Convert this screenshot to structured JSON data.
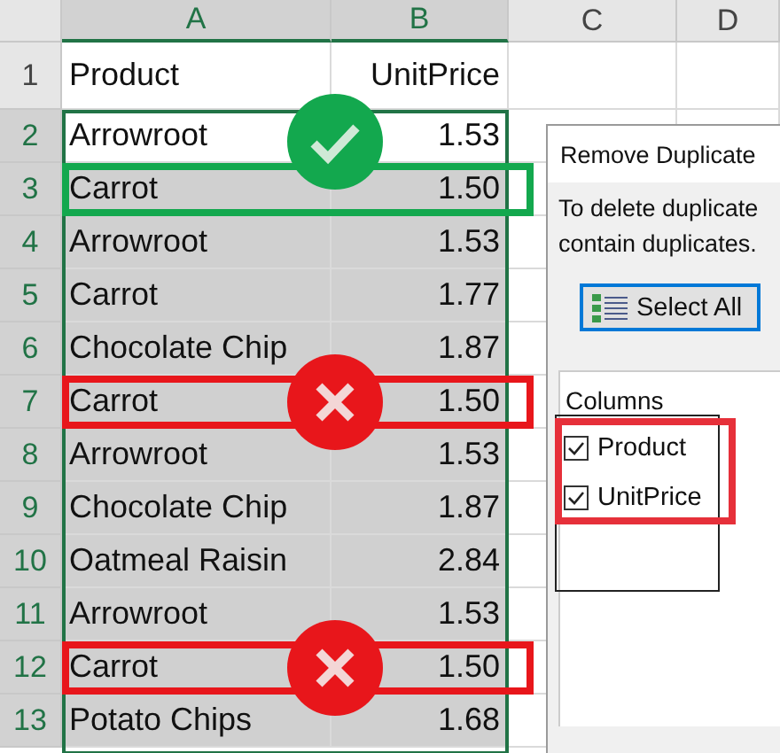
{
  "column_headers": [
    {
      "label": "A",
      "selected": true
    },
    {
      "label": "B",
      "selected": true
    },
    {
      "label": "C",
      "selected": false
    },
    {
      "label": "D",
      "selected": false
    }
  ],
  "rows": [
    {
      "number": "1",
      "cells": [
        "Product",
        "UnitPrice"
      ],
      "selected": false,
      "active": false,
      "kind": "normal"
    },
    {
      "number": "2",
      "cells": [
        "Arrowroot",
        "1.53"
      ],
      "selected": true,
      "active": true,
      "kind": "normal"
    },
    {
      "number": "3",
      "cells": [
        "Carrot",
        "1.50"
      ],
      "selected": true,
      "active": false,
      "kind": "keep"
    },
    {
      "number": "4",
      "cells": [
        "Arrowroot",
        "1.53"
      ],
      "selected": true,
      "active": false,
      "kind": "normal"
    },
    {
      "number": "5",
      "cells": [
        "Carrot",
        "1.77"
      ],
      "selected": true,
      "active": false,
      "kind": "normal"
    },
    {
      "number": "6",
      "cells": [
        "Chocolate Chip",
        "1.87"
      ],
      "selected": true,
      "active": false,
      "kind": "normal"
    },
    {
      "number": "7",
      "cells": [
        "Carrot",
        "1.50"
      ],
      "selected": true,
      "active": false,
      "kind": "remove"
    },
    {
      "number": "8",
      "cells": [
        "Arrowroot",
        "1.53"
      ],
      "selected": true,
      "active": false,
      "kind": "normal"
    },
    {
      "number": "9",
      "cells": [
        "Chocolate Chip",
        "1.87"
      ],
      "selected": true,
      "active": false,
      "kind": "normal"
    },
    {
      "number": "10",
      "cells": [
        "Oatmeal Raisin",
        "2.84"
      ],
      "selected": true,
      "active": false,
      "kind": "normal"
    },
    {
      "number": "11",
      "cells": [
        "Arrowroot",
        "1.53"
      ],
      "selected": true,
      "active": false,
      "kind": "normal"
    },
    {
      "number": "12",
      "cells": [
        "Carrot",
        "1.50"
      ],
      "selected": true,
      "active": false,
      "kind": "remove"
    },
    {
      "number": "13",
      "cells": [
        "Potato Chips",
        "1.68"
      ],
      "selected": true,
      "active": false,
      "kind": "normal"
    }
  ],
  "dialog": {
    "title": "Remove Duplicate",
    "message_lines": [
      "To delete duplicate",
      "contain duplicates."
    ],
    "select_all_button": "Select All",
    "columns_label": "Columns",
    "columns": [
      {
        "label": "Product",
        "checked": true
      },
      {
        "label": "UnitPrice",
        "checked": true
      }
    ]
  }
}
